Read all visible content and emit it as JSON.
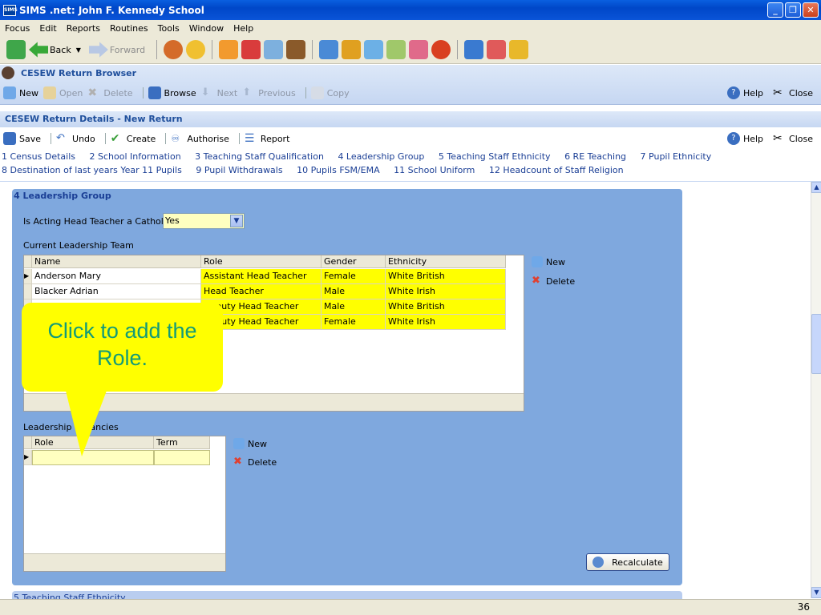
{
  "window": {
    "title": "SIMS .net: John F. Kennedy School",
    "app_icon": "SIMS"
  },
  "menu": [
    "Focus",
    "Edit",
    "Reports",
    "Routines",
    "Tools",
    "Window",
    "Help"
  ],
  "toolbar": {
    "back": "Back",
    "forward": "Forward"
  },
  "browser": {
    "title": "CESEW Return Browser",
    "actions": [
      "New",
      "Open",
      "Delete",
      "Browse",
      "Next",
      "Previous",
      "Copy"
    ],
    "help": "Help",
    "close": "Close"
  },
  "details": {
    "title": "CESEW Return Details - New Return",
    "actions": [
      "Save",
      "Undo",
      "Create",
      "Authorise",
      "Report"
    ],
    "help": "Help",
    "close": "Close",
    "links_row1": [
      "1 Census Details",
      "2 School Information",
      "3 Teaching Staff Qualification",
      "4 Leadership Group",
      "5 Teaching Staff Ethnicity",
      "6 RE Teaching",
      "7 Pupil Ethnicity"
    ],
    "links_row2": [
      "8 Destination of last years Year 11 Pupils",
      "9 Pupil Withdrawals",
      "10 Pupils FSM/EMA",
      "11 School Uniform",
      "12 Headcount of Staff Religion"
    ]
  },
  "section": {
    "heading": "4 Leadership Group",
    "acting_head_label": "Is Acting Head Teacher a Catholic",
    "acting_head_value": "Yes",
    "team_label": "Current Leadership Team",
    "team_columns": [
      "Name",
      "Role",
      "Gender",
      "Ethnicity"
    ],
    "team_rows": [
      {
        "name": "Anderson Mary",
        "role": "Assistant Head Teacher",
        "gender": "Female",
        "ethnicity": "White British"
      },
      {
        "name": "Blacker Adrian",
        "role": "Head Teacher",
        "gender": "Male",
        "ethnicity": "White Irish"
      },
      {
        "name": "",
        "role": "Deputy Head Teacher",
        "gender": "Male",
        "ethnicity": "White British"
      },
      {
        "name": "",
        "role": "Deputy Head Teacher",
        "gender": "Female",
        "ethnicity": "White Irish"
      }
    ],
    "team_new": "New",
    "team_delete": "Delete",
    "vacancies_label": "Leadership Vacancies",
    "vacancy_columns": [
      "Role",
      "Term"
    ],
    "vac_new": "New",
    "vac_delete": "Delete",
    "recalculate": "Recalculate",
    "next_section": "5 Teaching Staff Ethnicity"
  },
  "callout": {
    "text": "Click to add the Role.",
    "color": "#ffff00",
    "text_color": "#139b77"
  },
  "status": {
    "page_number": "36"
  }
}
